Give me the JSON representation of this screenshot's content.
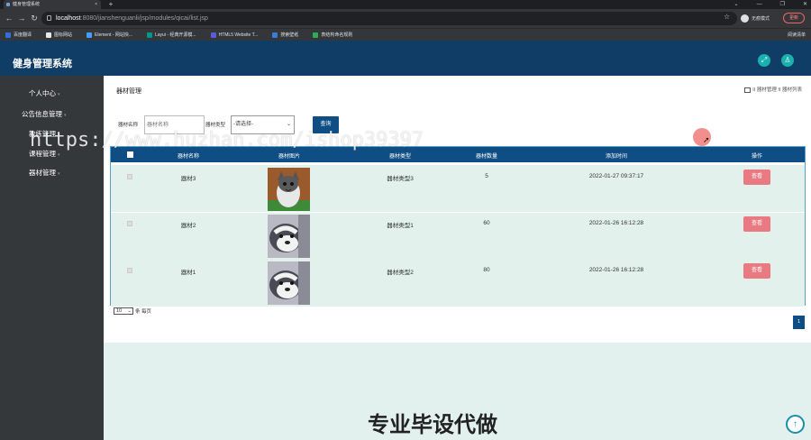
{
  "browser": {
    "tab_title": "健身管理系统",
    "url_host": "localhost",
    "url_path": ":8080/jianshenguanli/jsp/modules/qicai/list.jsp",
    "profile_label": "无痕模式",
    "update_label": "更新",
    "reading_list": "阅读清单",
    "bookmarks": [
      {
        "label": "百度翻译",
        "color": "#2f6fdd"
      },
      {
        "label": "图标网站",
        "color": "#e8e8e8"
      },
      {
        "label": "Element - 网站快...",
        "color": "#409eff"
      },
      {
        "label": "Layui - 经典开源模...",
        "color": "#009688"
      },
      {
        "label": "HTML5 Website T...",
        "color": "#5b5bd6"
      },
      {
        "label": "搜索壁纸",
        "color": "#3a7bd5"
      },
      {
        "label": "表结构命名规则",
        "color": "#2eaa5a"
      }
    ]
  },
  "app": {
    "title": "健身管理系统"
  },
  "sidebar": {
    "items": [
      {
        "label": "个人中心"
      },
      {
        "label": "公告信息管理"
      },
      {
        "label": "教练管理"
      },
      {
        "label": "课程管理"
      },
      {
        "label": "器材管理"
      }
    ]
  },
  "page": {
    "title": "器材管理",
    "breadcrumb": "II 器材管理 II 器材列表"
  },
  "search": {
    "name_label": "器材名称",
    "name_placeholder": "器材名称",
    "type_label": "器材类型",
    "type_selected": "-请选择-",
    "button": "查询"
  },
  "table": {
    "headers": [
      "器材名称",
      "器材图片",
      "器材类型",
      "器材数量",
      "添加时间",
      "操作"
    ],
    "rows": [
      {
        "name": "器材3",
        "type": "器材类型3",
        "count": "5",
        "time": "2022-01-27 09:37:17",
        "action": "查看",
        "image": "cat"
      },
      {
        "name": "器材2",
        "type": "器材类型1",
        "count": "60",
        "time": "2022-01-26 16:12:28",
        "action": "查看",
        "image": "husky"
      },
      {
        "name": "器材1",
        "type": "器材类型2",
        "count": "80",
        "time": "2022-01-26 16:12:28",
        "action": "查看",
        "image": "husky"
      }
    ]
  },
  "pagination": {
    "per_page": "10",
    "per_page_suffix": "条 每页",
    "page": "1"
  },
  "overlay": {
    "watermark": "https://www.huzhan.com/ishop39397",
    "footer": "专业毕设代做"
  }
}
